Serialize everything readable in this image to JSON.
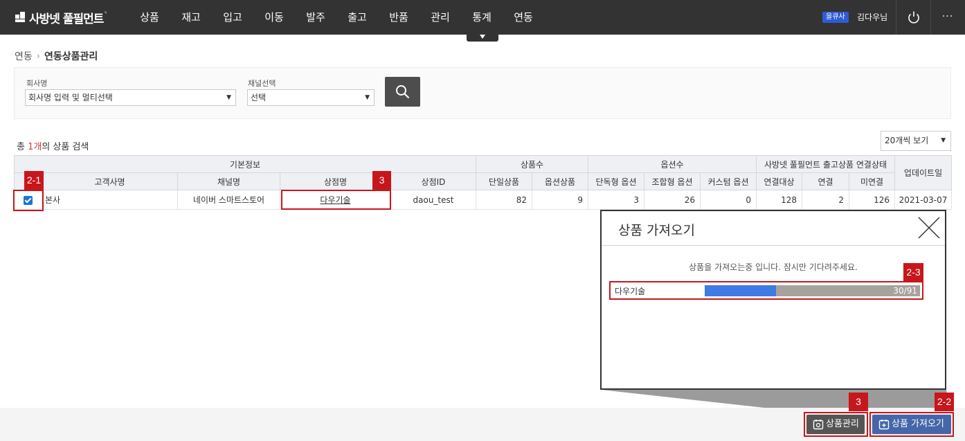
{
  "header": {
    "logo_text": "사방넷 풀필먼트",
    "nav": [
      "상품",
      "재고",
      "입고",
      "이동",
      "발주",
      "출고",
      "반품",
      "관리",
      "통계",
      "연동"
    ],
    "user_tag": "을큐사",
    "user_name": "김다우님"
  },
  "breadcrumb": {
    "parent": "연동",
    "current": "연동상품관리"
  },
  "search": {
    "company_label": "회사명",
    "company_value": "회사명 입력 및 멀티선택",
    "channel_label": "채널선택",
    "channel_value": "선택"
  },
  "result": {
    "prefix": "총 ",
    "count": "1개",
    "suffix": "의 상품 검색"
  },
  "view_select": "20개씩 보기",
  "table": {
    "group_headers": [
      "기본정보",
      "상품수",
      "옵션수",
      "사방넷 풀필먼트 출고상품 연결상태",
      "업데이트일"
    ],
    "columns": [
      "고객사명",
      "채널명",
      "상점명",
      "상점ID",
      "단일상품",
      "옵션상품",
      "단독형 옵션",
      "조합형 옵션",
      "커스텀 옵션",
      "연결대상",
      "연결",
      "미연결"
    ],
    "row": {
      "customer": "본사",
      "channel": "네이버 스마트스토어",
      "store": "다우기술",
      "store_id": "daou_test",
      "single": "82",
      "option_products": "9",
      "standalone_opt": "3",
      "combo_opt": "26",
      "custom_opt": "0",
      "link_target": "128",
      "linked": "2",
      "unlinked": "126",
      "updated": "2021-03-07"
    }
  },
  "modal": {
    "title": "상품 가져오기",
    "message": "상품을 가져오는중 입니다. 잠시만 기다려주세요.",
    "progress_name": "다우기술",
    "progress_text": "30/91",
    "progress_done": 30,
    "progress_total": 91
  },
  "annotations": {
    "a21": "2-1",
    "a3": "3",
    "a23": "2-3",
    "a3b": "3",
    "a22": "2-2"
  },
  "buttons": {
    "manage": "상품관리",
    "import": "상품 가져오기"
  },
  "colors": {
    "topbar": "#333333",
    "accent_red": "#c8161d",
    "progress_fill": "#3e7be4",
    "import_button": "#4566a8"
  }
}
